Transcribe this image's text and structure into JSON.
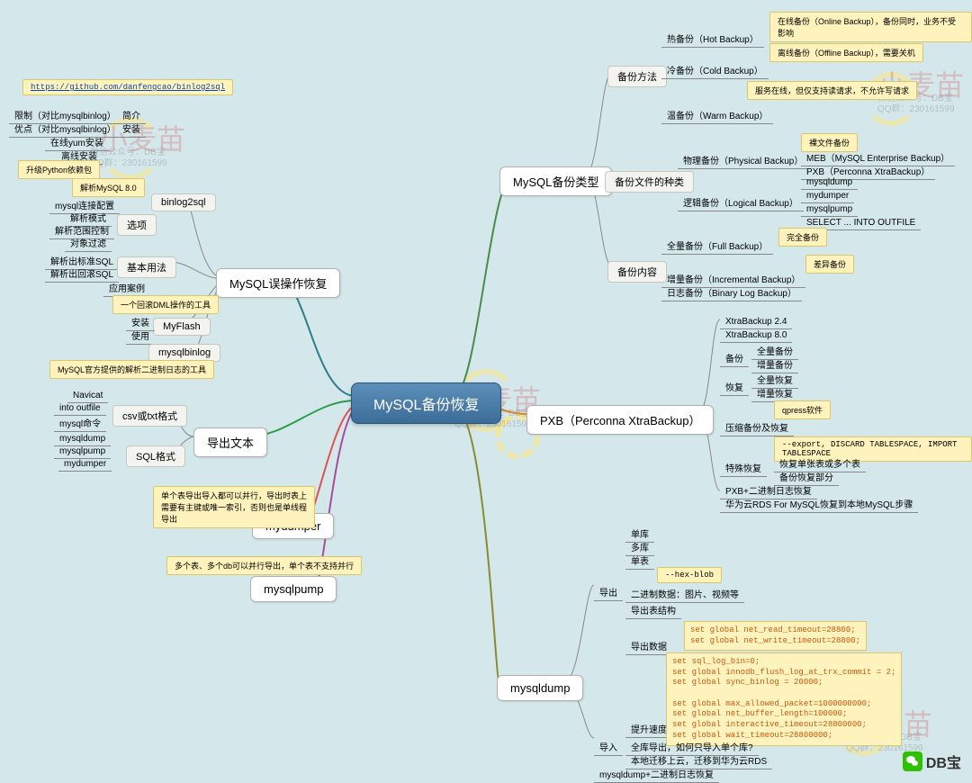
{
  "root": "MySQL备份恢复",
  "watermarks": {
    "red": "小麦苗",
    "gray1": "微信公众号：DB宝",
    "gray2": "QQ群：230161599"
  },
  "branches": {
    "misoperation": {
      "title": "MySQL误操作恢复",
      "github": "https://github.com/danfengcao/binlog2sql",
      "items": {
        "intro": "简介",
        "install": "安装",
        "bin2sql": "binlog2sql",
        "limit": "限制（对比mysqlbinlog）",
        "advantage": "优点（对比mysqlbinlog）",
        "yum": "在线yum安装",
        "offline": "离线安装",
        "pyupgrade": "升级Python依赖包",
        "parse8": "解析MySQL 8.0",
        "conncfg": "mysql连接配置",
        "parsemode": "解析模式",
        "rangectrl": "解析范围控制",
        "objfilter": "对象过滤",
        "options": "选项",
        "parsestd": "解析出标准SQL",
        "parserollback": "解析出回滚SQL",
        "basic": "基本用法",
        "appcase": "应用案例",
        "dmltool": "一个回滚DML操作的工具",
        "myflash": "MyFlash",
        "mf_install": "安装",
        "mf_use": "使用",
        "mysqlbinlog": "mysqlbinlog",
        "official": "MySQL官方提供的解析二进制日志的工具"
      }
    },
    "export": {
      "title": "导出文本",
      "csvtxt": "csv或txt格式",
      "sql": "SQL格式",
      "navicat": "Navicat",
      "intooutfile": "into outfile",
      "mysqlcmd": "mysql命令",
      "mysqldump": "mysqldump",
      "mysqlpump": "mysqlpump",
      "mydumper": "mydumper"
    },
    "mydumper": {
      "title": "mydumper",
      "note": "单个表导出导入都可以并行，导出时表上需要有主键或唯一索引，否则也是单线程导出"
    },
    "mysqlpump": {
      "title": "mysqlpump",
      "note": "多个表、多个db可以并行导出，单个表不支持并行"
    },
    "mysqldump": {
      "title": "mysqldump",
      "export": "导出",
      "danku": "单库",
      "duoku": "多库",
      "danbiao": "单表",
      "hexblob": "--hex-blob",
      "binary": "二进制数据：图片、视频等",
      "tablestruct": "导出表结构",
      "exportdata": "导出数据",
      "timeout_code": "set global net_read_timeout=28800;\nset global net_write_timeout=28800;",
      "import": "导入",
      "speedup": "提升速度",
      "speedcode": "set sql_log_bin=0;\nset global innodb_flush_log_at_trx_commit = 2;\nset global sync_binlog = 20000;\n\nset global max_allowed_packet=1000000000;\nset global net_buffer_length=100000;\nset global interactive_timeout=28800000;\nset global wait_timeout=28800000;",
      "fullexport": "全库导出，如何只导入单个库?",
      "migrate": "本地迁移上云，迁移到华为云RDS",
      "binlogrestore": "mysqldump+二进制日志恢复"
    },
    "backuptype": {
      "title": "MySQL备份类型",
      "method": "备份方法",
      "hot": "热备份（Hot Backup）",
      "hot_note": "在线备份（Online Backup），备份同时，业务不受影响",
      "cold": "冷备份（Cold Backup）",
      "cold_note": "离线备份（Offline Backup），需要关机",
      "warm": "温备份（Warm Backup）",
      "warm_note": "服务在线，但仅支持读请求，不允许写请求",
      "filetype": "备份文件的种类",
      "physical": "物理备份（Physical Backup）",
      "naked": "裸文件备份",
      "meb": "MEB（MySQL Enterprise Backup）",
      "pxb": "PXB（Perconna XtraBackup）",
      "logical": "逻辑备份（Logical Backup）",
      "l_mysqldump": "mysqldump",
      "l_mydumper": "mydumper",
      "l_mysqlpump": "mysqlpump",
      "l_select": "SELECT ... INTO OUTFILE",
      "content": "备份内容",
      "full": "全量备份（Full Backup）",
      "full_note": "完全备份",
      "incr": "增量备份（Incremental Backup）",
      "incr_note": "差异备份",
      "binlog": "日志备份（Binary Log Backup）"
    },
    "pxb": {
      "title": "PXB（Perconna XtraBackup）",
      "v24": "XtraBackup 2.4",
      "v80": "XtraBackup 8.0",
      "backup": "备份",
      "fullbk": "全量备份",
      "incrbk": "增量备份",
      "restore": "恢复",
      "fullrs": "全量恢复",
      "incrrs": "增量恢复",
      "qpress": "qpress软件",
      "compress": "压缩备份及恢复",
      "special": "特殊恢复",
      "exportnote": "--export, DISCARD TABLESPACE, IMPORT TABLESPACE",
      "restoretable": "恢复单张表或多个表",
      "restorepart": "备份恢复部分",
      "pxbbinlog": "PXB+二进制日志恢复",
      "huawei": "华为云RDS For MySQL恢复到本地MySQL步骤"
    }
  },
  "brand": "DB宝"
}
